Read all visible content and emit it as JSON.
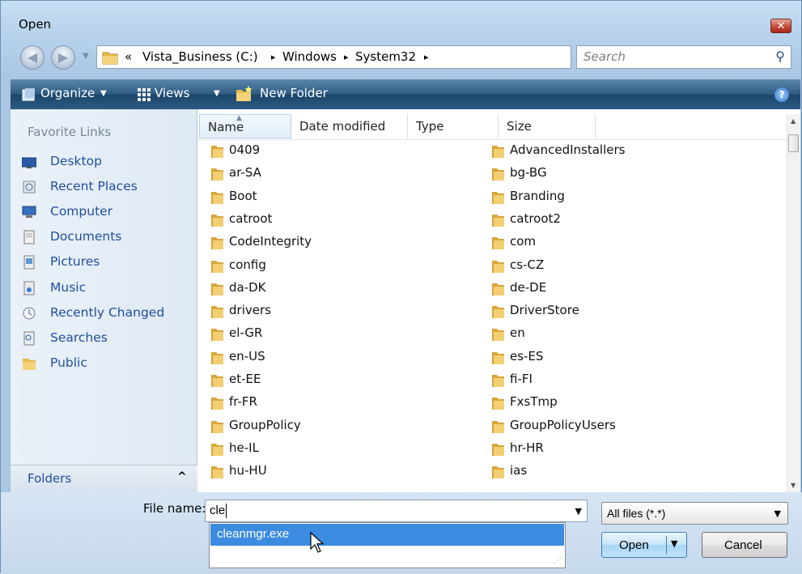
{
  "window": {
    "title": "Open",
    "close_glyph": "✕"
  },
  "address_bar": {
    "overflow_marker": "«",
    "crumbs": [
      "Vista_Business (C:)",
      "Windows",
      "System32"
    ],
    "separator": "▸",
    "dropdown_glyph": "▼",
    "refresh_glyph": "↻"
  },
  "search": {
    "placeholder": "Search",
    "icon": "magnifier-icon"
  },
  "toolbar": {
    "organize": "Organize",
    "views": "Views",
    "new_folder": "New Folder",
    "dropdown_glyph": "▼",
    "help_glyph": "?"
  },
  "nav_pane": {
    "header": "Favorite Links",
    "items": [
      {
        "label": "Desktop",
        "icon": "desktop-icon"
      },
      {
        "label": "Recent Places",
        "icon": "recent-places-icon"
      },
      {
        "label": "Computer",
        "icon": "computer-icon"
      },
      {
        "label": "Documents",
        "icon": "documents-icon"
      },
      {
        "label": "Pictures",
        "icon": "pictures-icon"
      },
      {
        "label": "Music",
        "icon": "music-icon"
      },
      {
        "label": "Recently Changed",
        "icon": "recently-changed-icon"
      },
      {
        "label": "Searches",
        "icon": "searches-icon"
      },
      {
        "label": "Public",
        "icon": "public-folder-icon"
      }
    ],
    "folders_label": "Folders",
    "folders_chevron": "^"
  },
  "columns": [
    "Name",
    "Date modified",
    "Type",
    "Size"
  ],
  "files_col1": [
    "0409",
    "ar-SA",
    "Boot",
    "catroot",
    "CodeIntegrity",
    "config",
    "da-DK",
    "drivers",
    "el-GR",
    "en-US",
    "et-EE",
    "fr-FR",
    "GroupPolicy",
    "he-IL",
    "hu-HU"
  ],
  "files_col2": [
    "AdvancedInstallers",
    "bg-BG",
    "Branding",
    "catroot2",
    "com",
    "cs-CZ",
    "de-DE",
    "DriverStore",
    "en",
    "es-ES",
    "fi-FI",
    "FxsTmp",
    "GroupPolicyUsers",
    "hr-HR",
    "ias"
  ],
  "file_name": {
    "label": "File name:",
    "value": "cle",
    "dropdown_glyph": "▼"
  },
  "autocomplete": {
    "suggestion": "cleanmgr.exe"
  },
  "filter": {
    "value": "All files (*.*)",
    "dropdown_glyph": "▼"
  },
  "buttons": {
    "open": "Open",
    "open_split_glyph": "▼",
    "cancel": "Cancel"
  }
}
